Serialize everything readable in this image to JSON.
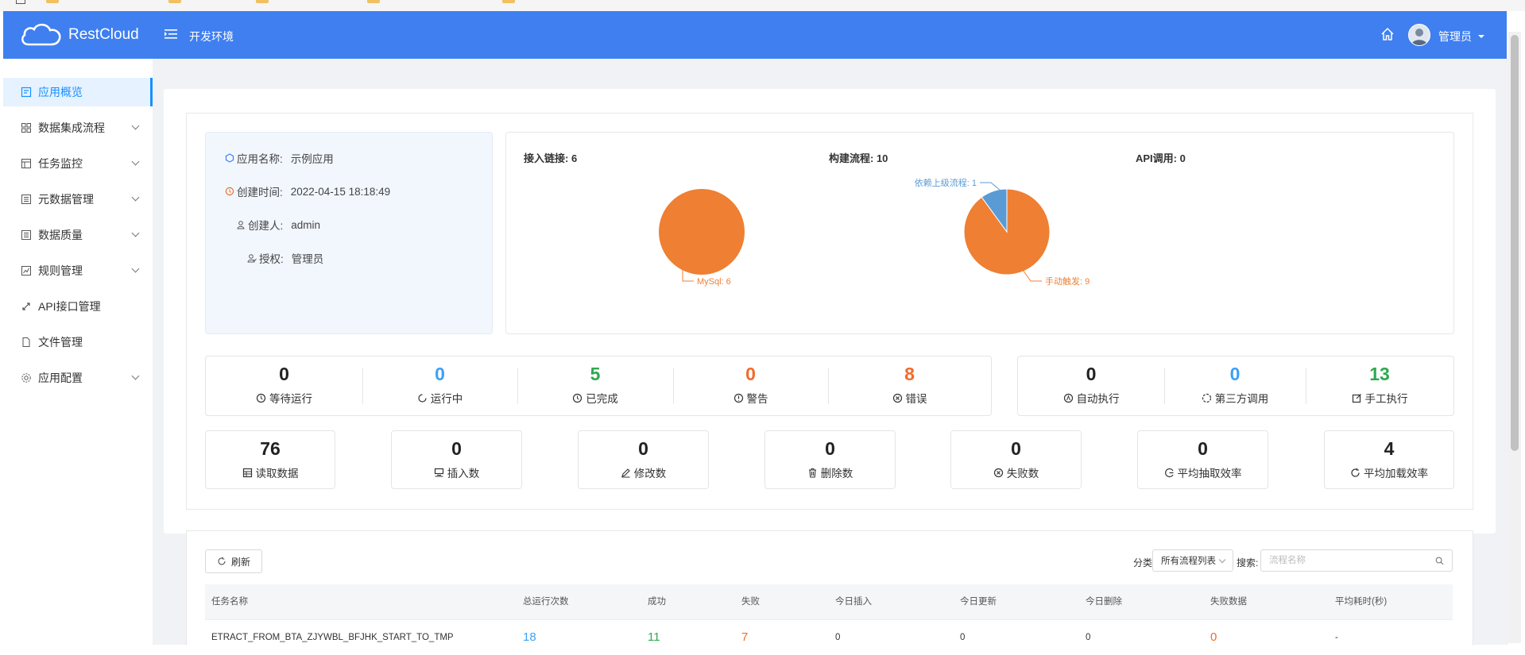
{
  "app": {
    "brand": "RestCloud",
    "environment": "开发环境",
    "user": "管理员"
  },
  "sidebar": {
    "items": [
      {
        "label": "应用概览",
        "icon": "overview-icon",
        "active": true
      },
      {
        "label": "数据集成流程",
        "icon": "flow-icon",
        "expandable": true
      },
      {
        "label": "任务监控",
        "icon": "monitor-icon",
        "expandable": true
      },
      {
        "label": "元数据管理",
        "icon": "metadata-icon",
        "expandable": true
      },
      {
        "label": "数据质量",
        "icon": "quality-icon",
        "expandable": true
      },
      {
        "label": "规则管理",
        "icon": "rules-icon",
        "expandable": true
      },
      {
        "label": "API接口管理",
        "icon": "api-icon"
      },
      {
        "label": "文件管理",
        "icon": "file-icon"
      },
      {
        "label": "应用配置",
        "icon": "config-icon",
        "expandable": true
      }
    ]
  },
  "info": {
    "name_label": "应用名称:",
    "name": "示例应用",
    "created_label": "创建时间:",
    "created": "2022-04-15 18:18:49",
    "creator_label": "创建人:",
    "creator": "admin",
    "auth_label": "授权:",
    "auth": "管理员"
  },
  "charts": {
    "access_title": "接入链接: 6",
    "build_title": "构建流程: 10",
    "api_title": "API调用: 0"
  },
  "chart_data": [
    {
      "type": "pie",
      "title": "接入链接: 6",
      "slices": [
        {
          "label": "MySql: 6",
          "value": 6,
          "color": "#ee7f33"
        }
      ]
    },
    {
      "type": "pie",
      "title": "构建流程: 10",
      "slices": [
        {
          "label": "手动触发: 9",
          "value": 9,
          "color": "#ee7f33"
        },
        {
          "label": "依赖上级流程: 1",
          "value": 1,
          "color": "#5b9bd5"
        }
      ]
    }
  ],
  "run_status": [
    {
      "value": "0",
      "label": "等待运行",
      "color": "#222222",
      "icon": "clock-icon"
    },
    {
      "value": "0",
      "label": "运行中",
      "color": "#3ba1f5",
      "icon": "loading-icon"
    },
    {
      "value": "5",
      "label": "已完成",
      "color": "#2fa84f",
      "icon": "clock-icon"
    },
    {
      "value": "0",
      "label": "警告",
      "color": "#f06b2c",
      "icon": "warning-icon"
    },
    {
      "value": "8",
      "label": "错误",
      "color": "#f06b2c",
      "icon": "error-icon"
    }
  ],
  "exec_types": [
    {
      "value": "0",
      "label": "自动执行",
      "color": "#222222",
      "icon": "auto-icon"
    },
    {
      "value": "0",
      "label": "第三方调用",
      "color": "#3ba1f5",
      "icon": "third-party-icon"
    },
    {
      "value": "13",
      "label": "手工执行",
      "color": "#2fa84f",
      "icon": "manual-icon"
    }
  ],
  "metrics": [
    {
      "value": "76",
      "label": "读取数据",
      "icon": "read-icon"
    },
    {
      "value": "0",
      "label": "插入数",
      "icon": "insert-icon"
    },
    {
      "value": "0",
      "label": "修改数",
      "icon": "edit-icon"
    },
    {
      "value": "0",
      "label": "删除数",
      "icon": "delete-icon"
    },
    {
      "value": "0",
      "label": "失败数",
      "icon": "fail-icon"
    },
    {
      "value": "0",
      "label": "平均抽取效率",
      "icon": "extract-icon"
    },
    {
      "value": "4",
      "label": "平均加载效率",
      "icon": "load-icon"
    }
  ],
  "table": {
    "refresh_label": "刷新",
    "filter_label": "分类:",
    "filter_value": "所有流程列表",
    "search_label": "搜索:",
    "search_placeholder": "流程名称",
    "columns": [
      "任务名称",
      "总运行次数",
      "成功",
      "失败",
      "今日插入",
      "今日更新",
      "今日删除",
      "失败数据",
      "平均耗时(秒)"
    ],
    "rows": [
      [
        "ETRACT_FROM_BTA_ZJYWBL_BFJHK_START_TO_TMP",
        "18",
        "11",
        "7",
        "0",
        "0",
        "0",
        "0",
        "-"
      ]
    ],
    "value_colors": {
      "total": "#3ba1f5",
      "success": "#2fa84f",
      "fail": "#f06b2c",
      "fail_data": "#f06b2c"
    }
  }
}
